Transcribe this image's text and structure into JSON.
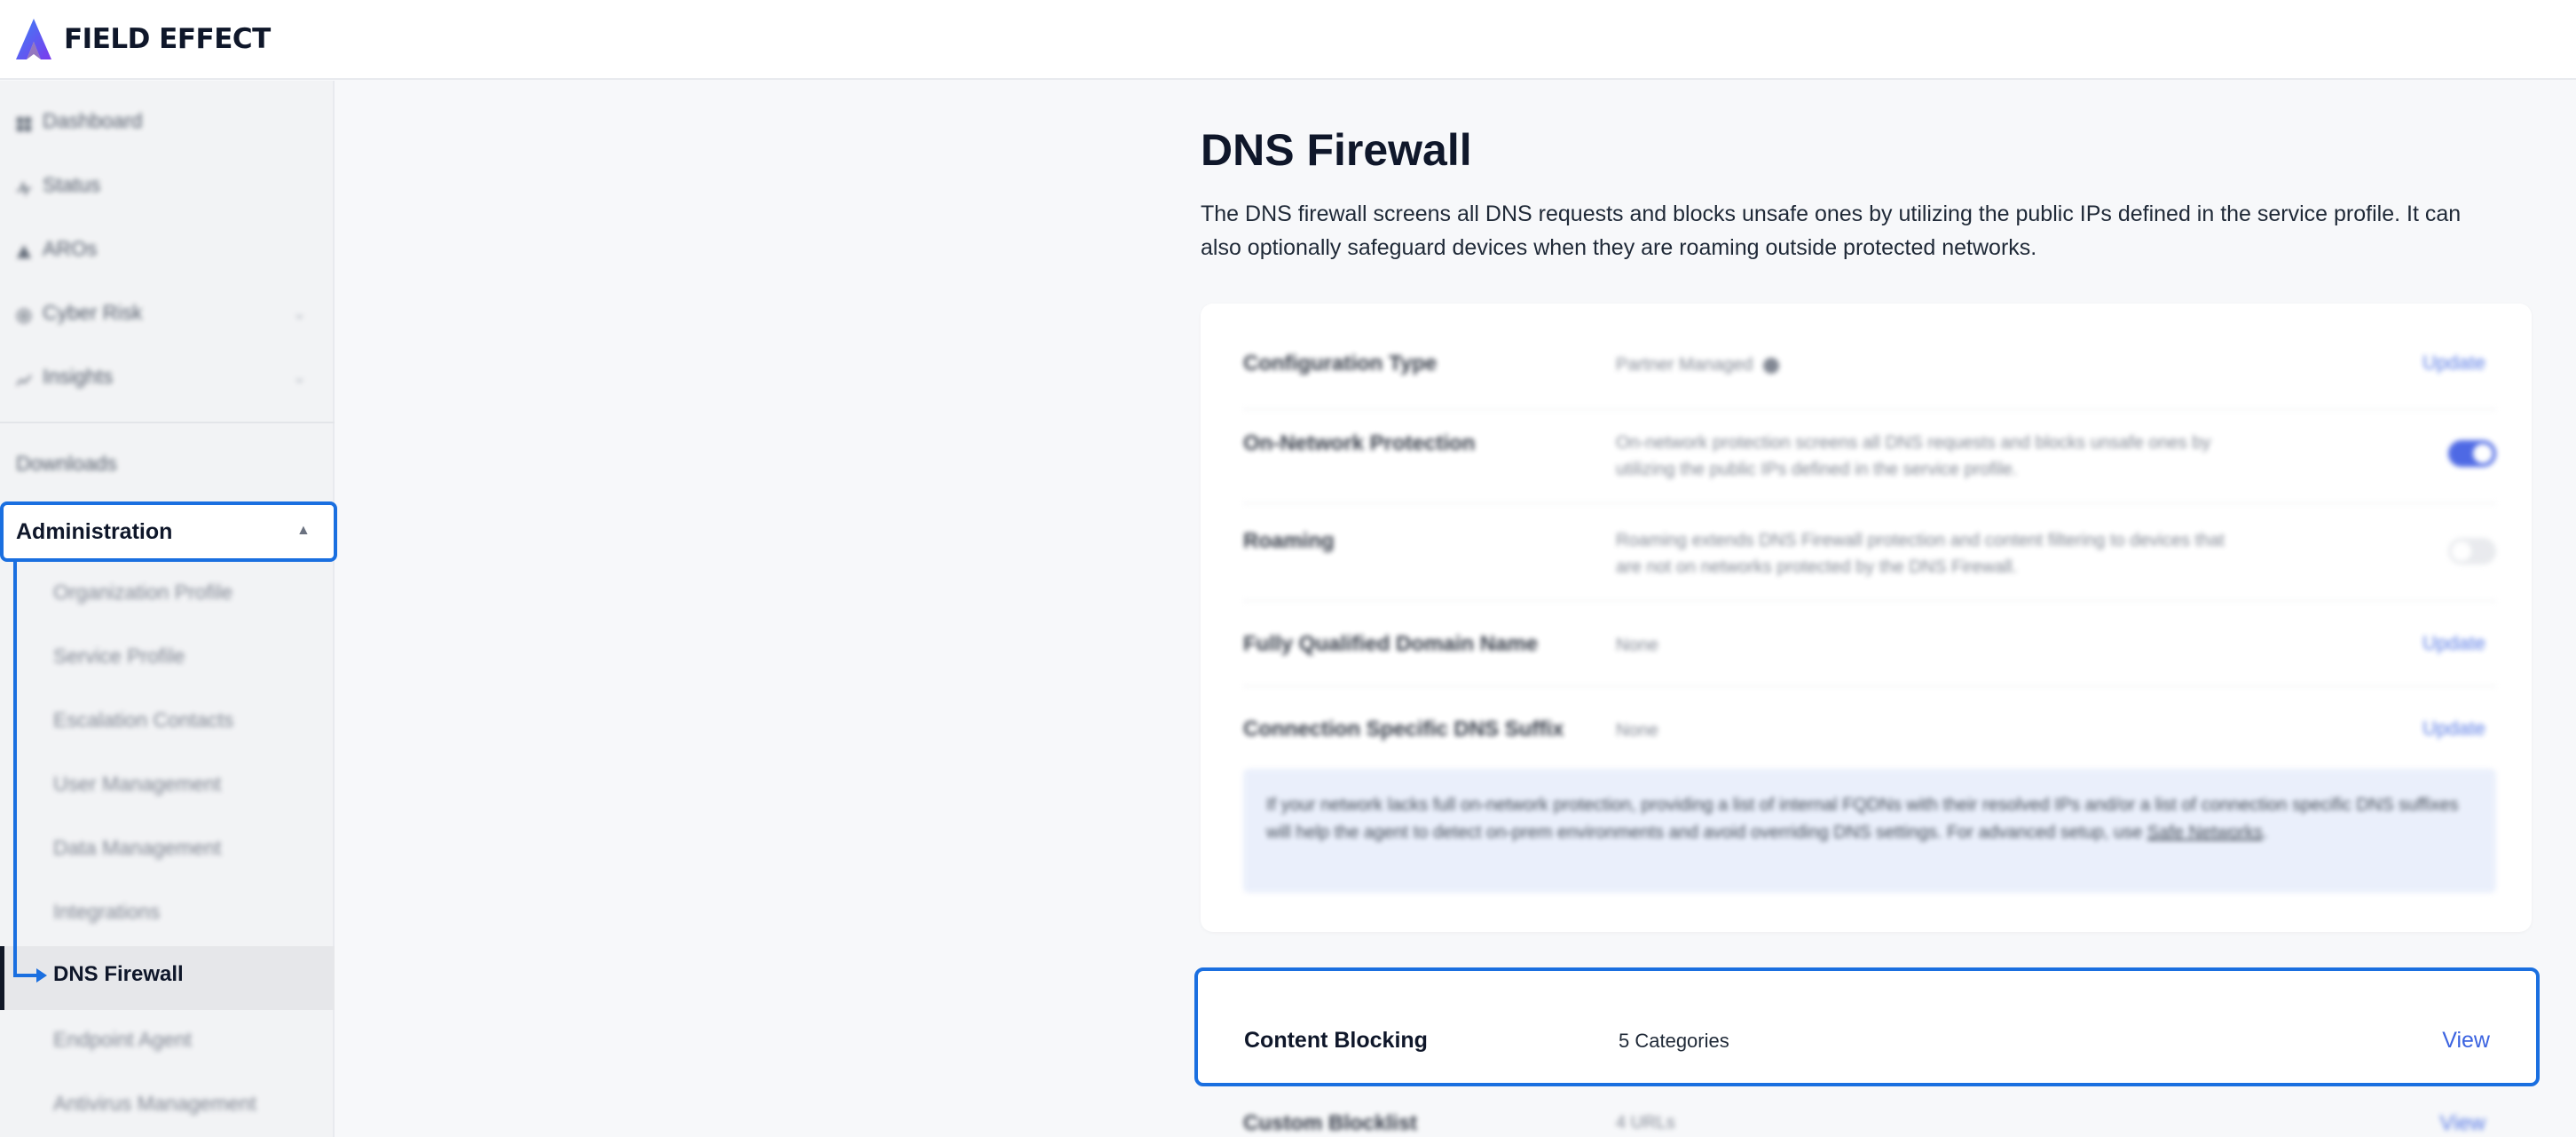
{
  "brand": {
    "name": "FIELD EFFECT"
  },
  "colors": {
    "accent": "#1a6fe0",
    "link": "#3b63e0",
    "info_bg": "#e7edfb",
    "toggle_on": "#2f4fe0"
  },
  "sidebar": {
    "nav": [
      {
        "label": "Dashboard",
        "icon": "grid-icon"
      },
      {
        "label": "Status",
        "icon": "pulse-icon"
      },
      {
        "label": "AROs",
        "icon": "alert-icon"
      },
      {
        "label": "Cyber Risk",
        "icon": "target-icon"
      },
      {
        "label": "Insights",
        "icon": "chart-icon"
      }
    ],
    "downloads": "Downloads",
    "admin": "Administration",
    "admin_items": [
      "Organization Profile",
      "Service Profile",
      "Escalation Contacts",
      "User Management",
      "Data Management",
      "Integrations",
      "DNS Firewall",
      "Endpoint Agent",
      "Antivirus Management"
    ],
    "active_item": "DNS Firewall"
  },
  "page": {
    "title": "DNS Firewall",
    "description": "The DNS firewall screens all DNS requests and blocks unsafe ones by utilizing the public IPs defined in the service profile. It can also optionally safeguard devices when they are roaming outside protected networks."
  },
  "config": {
    "rows": [
      {
        "label": "Configuration Type",
        "value": "Partner Managed",
        "action": "Update"
      },
      {
        "label": "On-Network Protection",
        "value": "On-network protection screens all DNS requests and blocks unsafe ones by utilizing the public IPs defined in the service profile.",
        "toggle": true
      },
      {
        "label": "Roaming",
        "value": "Roaming extends DNS Firewall protection and content filtering to devices that are not on networks protected by the DNS Firewall.",
        "toggle": false
      },
      {
        "label": "Fully Qualified Domain Name",
        "value": "None",
        "action": "Update"
      },
      {
        "label": "Connection Specific DNS Suffix",
        "value": "None",
        "action": "Update"
      }
    ],
    "info_text": "If your network lacks full on-network protection, providing a list of internal FQDNs with their resolved IPs and/or a list of connection specific DNS suffixes will help the agent to detect on-prem environments and avoid overriding DNS settings. For advanced setup, use",
    "info_link": "Safe Networks",
    "info_end": "."
  },
  "content_blocking": {
    "label": "Content Blocking",
    "value": "5 Categories",
    "action": "View"
  },
  "custom_blocklist": {
    "label": "Custom Blocklist",
    "value": "4 URLs",
    "action": "View"
  }
}
